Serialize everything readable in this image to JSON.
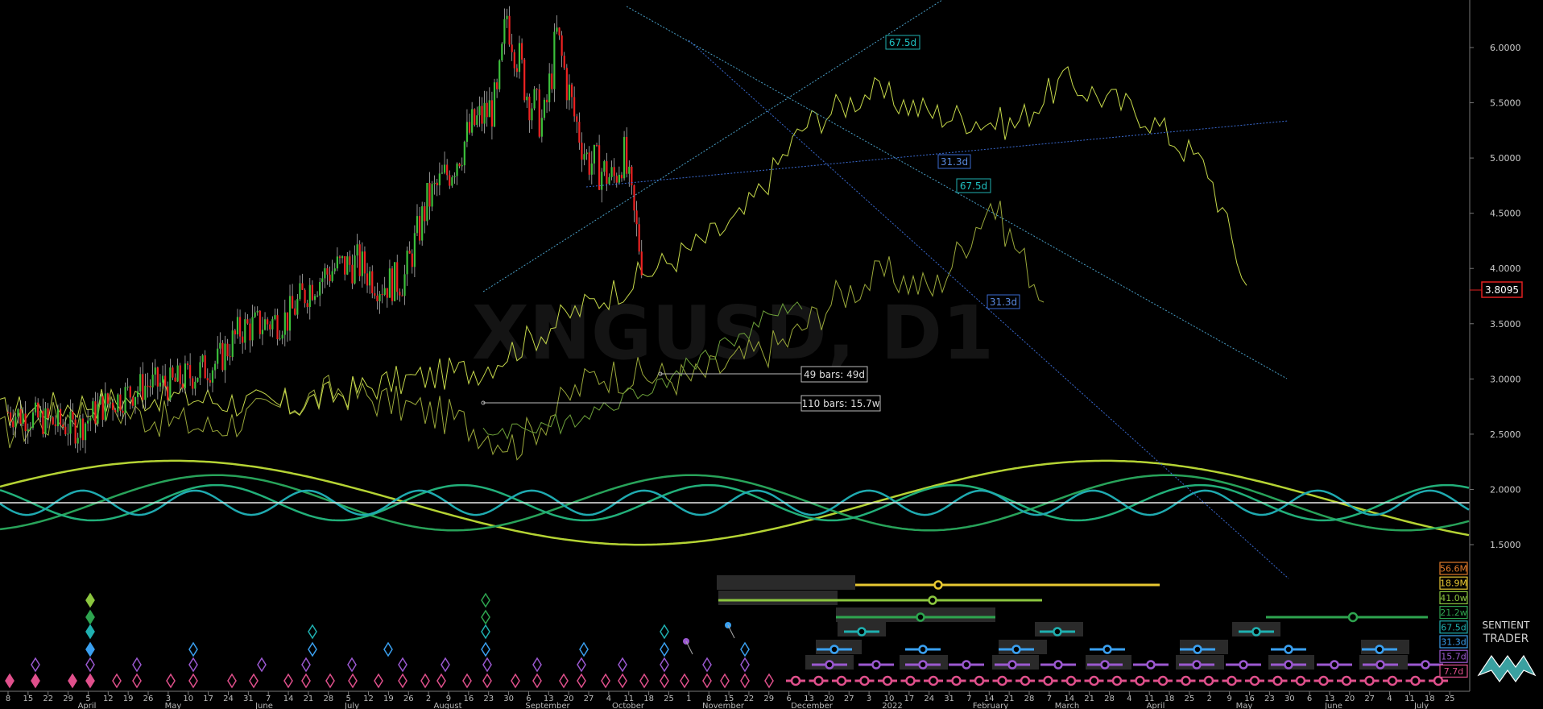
{
  "chart_data": {
    "type": "line",
    "symbol": "XNGUSD, D1",
    "last_price": "3.8095",
    "y_ticks": [
      "6.0000",
      "5.5000",
      "5.0000",
      "4.5000",
      "4.0000",
      "3.5000",
      "3.0000",
      "2.5000",
      "2.0000",
      "1.5000"
    ],
    "ylim": [
      1.0,
      6.4
    ],
    "day_ticks": [
      "8",
      "15",
      "22",
      "29",
      "5",
      "12",
      "19",
      "26",
      "3",
      "10",
      "17",
      "24",
      "31",
      "7",
      "14",
      "21",
      "28",
      "5",
      "12",
      "19",
      "26",
      "2",
      "9",
      "16",
      "23",
      "30",
      "6",
      "13",
      "20",
      "27",
      "4",
      "11",
      "18",
      "25",
      "1",
      "8",
      "15",
      "22",
      "29",
      "6",
      "13",
      "20",
      "27",
      "3",
      "10",
      "17",
      "24",
      "31",
      "7",
      "14",
      "21",
      "28",
      "7",
      "14",
      "21",
      "28",
      "4",
      "11",
      "18",
      "25",
      "2",
      "9",
      "16",
      "23",
      "30",
      "6",
      "13",
      "20",
      "27",
      "4",
      "11",
      "18",
      "25"
    ],
    "month_ticks": [
      "April",
      "May",
      "June",
      "July",
      "August",
      "September",
      "October",
      "November",
      "December",
      "2022",
      "February",
      "March",
      "April",
      "May",
      "June",
      "July"
    ],
    "annotations": {
      "bars_49": "49 bars: 49d",
      "bars_110": "110 bars: 15.7w",
      "p67a": "67.5d",
      "p31a": "31.3d",
      "p67b": "67.5d",
      "p31b": "31.3d"
    },
    "legend": [
      {
        "label": "56.6M",
        "color": "#e07a2a"
      },
      {
        "label": "18.9M",
        "color": "#e8c832"
      },
      {
        "label": "41.0w",
        "color": "#8cc63f"
      },
      {
        "label": "21.2w",
        "color": "#2ea44f"
      },
      {
        "label": "67.5d",
        "color": "#1fb0b0"
      },
      {
        "label": "31.3d",
        "color": "#3aa0f0"
      },
      {
        "label": "15.7d",
        "color": "#9b59d0"
      },
      {
        "label": "7.7d",
        "color": "#e0508c"
      }
    ],
    "cycles": [
      {
        "name": "18.9M",
        "color": "#b5d334",
        "period_days": 560,
        "phase_day": 100,
        "amp": 0.38
      },
      {
        "name": "41.0w",
        "color": "#28a35a",
        "period_days": 286,
        "phase_day": 125,
        "amp": 0.25
      },
      {
        "name": "21.2w",
        "color": "#22b07a",
        "period_days": 148,
        "phase_day": 125,
        "amp": 0.16
      },
      {
        "name": "67.5d",
        "color": "#1faab0",
        "period_days": 67.5,
        "phase_day": 45,
        "amp": 0.11
      }
    ],
    "price_path": [
      [
        0,
        2.7
      ],
      [
        14,
        2.65
      ],
      [
        28,
        2.6
      ],
      [
        42,
        2.55
      ],
      [
        56,
        2.75
      ],
      [
        70,
        2.85
      ],
      [
        84,
        2.95
      ],
      [
        98,
        2.95
      ],
      [
        112,
        3.05
      ],
      [
        126,
        3.15
      ],
      [
        140,
        3.45
      ],
      [
        154,
        3.5
      ],
      [
        168,
        3.55
      ],
      [
        182,
        3.85
      ],
      [
        196,
        4.0
      ],
      [
        210,
        4.05
      ],
      [
        224,
        3.85
      ],
      [
        238,
        3.9
      ],
      [
        252,
        4.6
      ],
      [
        266,
        4.9
      ],
      [
        280,
        5.3
      ],
      [
        294,
        5.5
      ],
      [
        300,
        6.3
      ],
      [
        312,
        5.6
      ],
      [
        322,
        5.3
      ],
      [
        330,
        6.1
      ],
      [
        340,
        5.4
      ],
      [
        348,
        5.0
      ],
      [
        356,
        4.9
      ],
      [
        364,
        4.8
      ],
      [
        370,
        5.05
      ],
      [
        376,
        4.5
      ],
      [
        382,
        4.0
      ]
    ],
    "brand": {
      "line1": "SENTIENT",
      "line2": "TRADER"
    }
  }
}
